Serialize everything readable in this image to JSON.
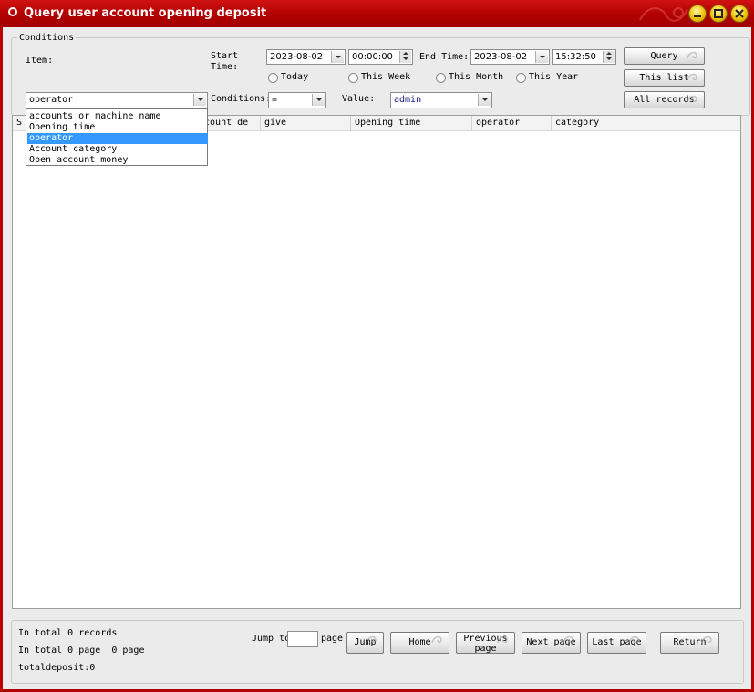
{
  "window": {
    "title": "Query user account opening deposit"
  },
  "conditions": {
    "legend": "Conditions",
    "item_label": "Item:",
    "start_time_label": "Start\nTime:",
    "start_date": "2023-08-02",
    "start_time": "00:00:00",
    "end_time_label": "End Time:",
    "end_date": "2023-08-02",
    "end_time": "15:32:50",
    "radios": [
      "Today",
      "This Week",
      "This Month",
      "This Year"
    ],
    "item_value": "operator",
    "conditions_label": "Conditions:",
    "conditions_value": "=",
    "value_label": "Value:",
    "value_value": "admin",
    "buttons": {
      "query": "Query",
      "this_list": "This list",
      "all_records": "All records"
    }
  },
  "item_dropdown": {
    "options": [
      "accounts or machine name",
      "Opening time",
      "operator",
      "Account category",
      "Open account money"
    ],
    "selected_index": 2
  },
  "grid": {
    "columns": [
      "S",
      "ccount de",
      "give",
      "Opening time",
      "operator",
      "category"
    ]
  },
  "footer": {
    "records": "In total 0 records",
    "pages": "In total 0 page  0 page",
    "total_deposit": "totaldeposit:0",
    "jump_to": "Jump to",
    "page": "page",
    "buttons": {
      "jump": "Jump",
      "home": "Home",
      "previous_page": "Previous page",
      "next_page": "Next page",
      "last_page": "Last page",
      "return": "Return"
    }
  },
  "colors": {
    "titlebar": "#b40000",
    "selection": "#3399ff",
    "window_control": "#f0c000"
  }
}
